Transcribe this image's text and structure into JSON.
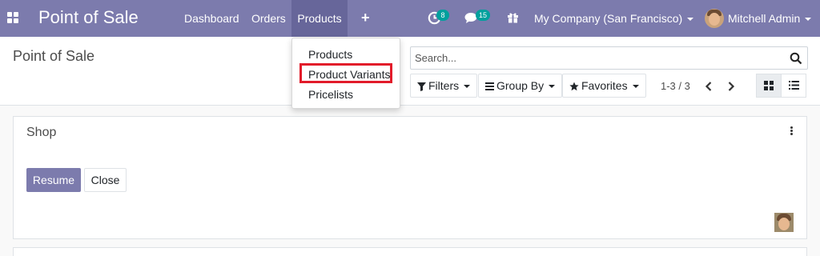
{
  "navbar": {
    "brand": "Point of Sale",
    "menus": [
      "Dashboard",
      "Orders",
      "Products"
    ],
    "active_menu": "Products",
    "plus_label": "+",
    "activity_count": "8",
    "messages_count": "15",
    "company": "My Company (San Francisco)",
    "user": "Mitchell Admin",
    "background_color": "#7c7bad"
  },
  "products_menu": {
    "items": [
      "Products",
      "Product Variants",
      "Pricelists"
    ],
    "highlighted": "Product Variants",
    "highlight_color": "#e21b2a"
  },
  "control_panel": {
    "breadcrumb": "Point of Sale",
    "search_placeholder": "Search...",
    "filters_label": "Filters",
    "group_by_label": "Group By",
    "favorites_label": "Favorites",
    "pager": "1-3 / 3",
    "active_view": "kanban"
  },
  "pos_cards": [
    {
      "title": "Shop",
      "primary_action": "Resume",
      "secondary_action": "Close"
    }
  ],
  "icons": [
    "apps-grid-icon",
    "activity-clock-icon",
    "chat-icon",
    "gift-icon",
    "search-icon",
    "filter-icon",
    "list-bars-icon",
    "star-icon",
    "chevron-left-icon",
    "chevron-right-icon",
    "kanban-view-icon",
    "list-view-icon",
    "kebab-menu-icon"
  ]
}
